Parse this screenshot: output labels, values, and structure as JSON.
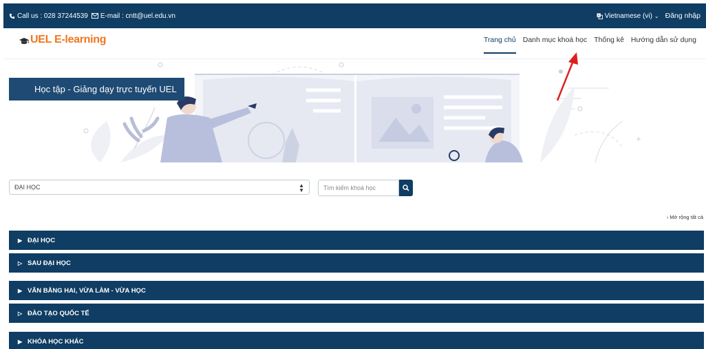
{
  "topbar": {
    "phone": "Call us : 028 37244539",
    "email": "E-mail : cntt@uel.edu.vn",
    "language": "Vietnamese (vi)",
    "login": "Đăng nhập"
  },
  "logo": {
    "text": "UEL E-learning"
  },
  "nav": {
    "items": [
      {
        "label": "Trang chủ",
        "active": true
      },
      {
        "label": "Danh mục khoá học",
        "active": false
      },
      {
        "label": "Thống kê",
        "active": false
      },
      {
        "label": "Hướng dẫn sử dụng",
        "active": false
      }
    ]
  },
  "hero": {
    "title": "Học tập - Giảng dạy trực tuyến UEL"
  },
  "filter": {
    "selected": "ĐẠI HỌC"
  },
  "search": {
    "placeholder": "Tìm kiếm khoá học"
  },
  "expand_all": "Mở rộng tất cả",
  "categories": [
    {
      "label": "ĐẠI HỌC",
      "has_children": true
    },
    {
      "label": "SAU ĐẠI HỌC",
      "has_children": false
    },
    {
      "label": "VĂN BẰNG HAI, VỪA LÀM - VỪA HỌC",
      "has_children": true
    },
    {
      "label": "ĐÀO TẠO QUỐC TẾ",
      "has_children": false
    },
    {
      "label": "KHÓA HỌC KHÁC",
      "has_children": true
    }
  ],
  "colors": {
    "primary": "#0f3d63",
    "logo": "#f0761d",
    "annotation": "#e01e1e"
  }
}
